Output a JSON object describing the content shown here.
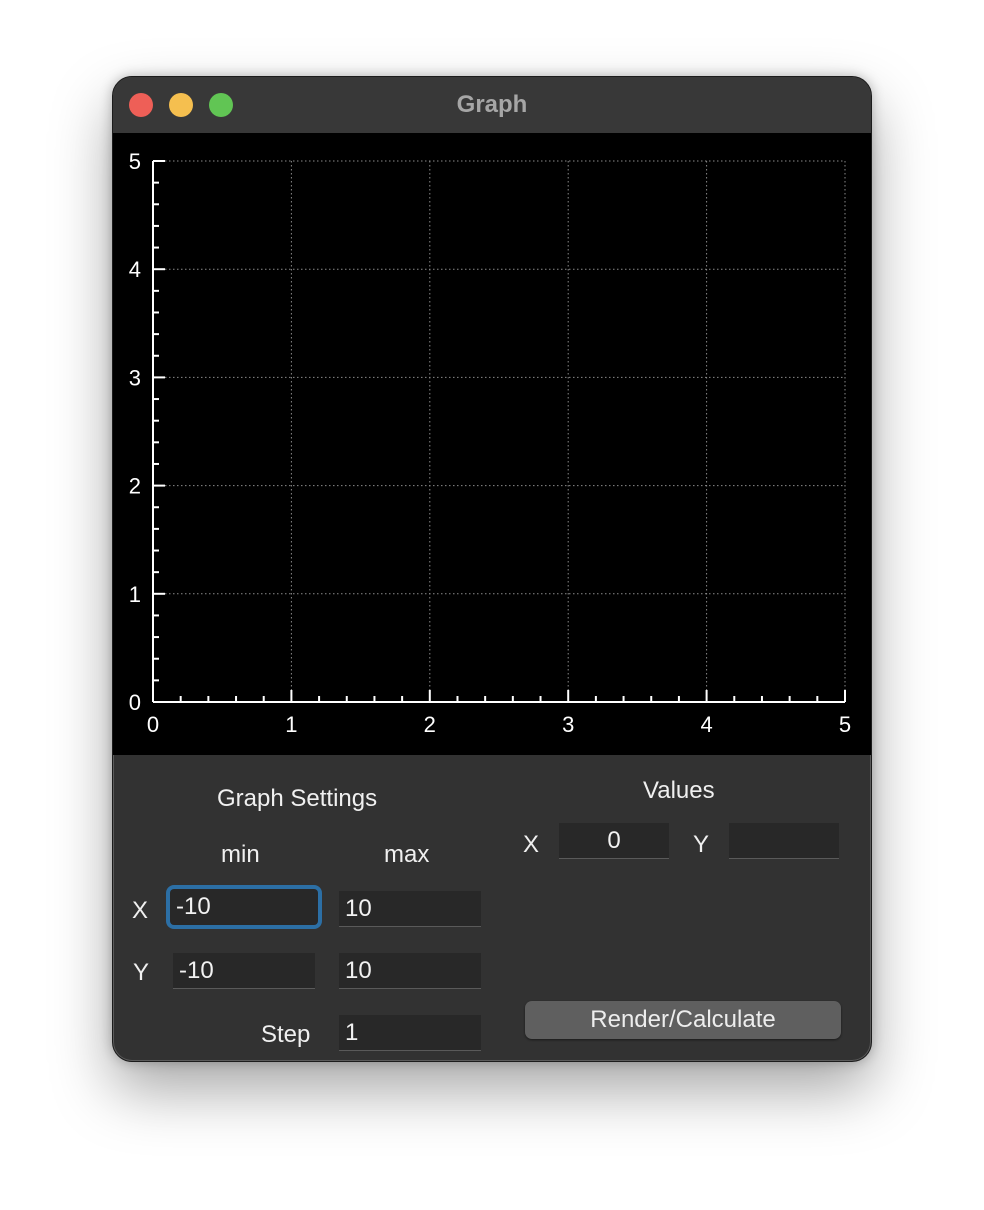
{
  "window": {
    "title": "Graph"
  },
  "chart_data": {
    "type": "line",
    "series": [],
    "xlim": [
      0,
      5
    ],
    "ylim": [
      0,
      5
    ],
    "xticks": [
      "0",
      "1",
      "2",
      "3",
      "4",
      "5"
    ],
    "yticks": [
      "0",
      "1",
      "2",
      "3",
      "4",
      "5"
    ],
    "grid": true,
    "background": "#000000",
    "axis_color": "#ffffff",
    "grid_color": "#8a8a8a"
  },
  "settings": {
    "heading": "Graph Settings",
    "min_label": "min",
    "max_label": "max",
    "x_label": "X",
    "y_label": "Y",
    "step_label": "Step",
    "x_min": "-10",
    "x_max": "10",
    "y_min": "-10",
    "y_max": "10",
    "step": "1"
  },
  "values": {
    "heading": "Values",
    "x_label": "X",
    "y_label": "Y",
    "x_value": "0",
    "y_value": ""
  },
  "render_button": "Render/Calculate",
  "colors": {
    "focus_ring": "#2c6fa5",
    "window_bg": "#323232"
  }
}
